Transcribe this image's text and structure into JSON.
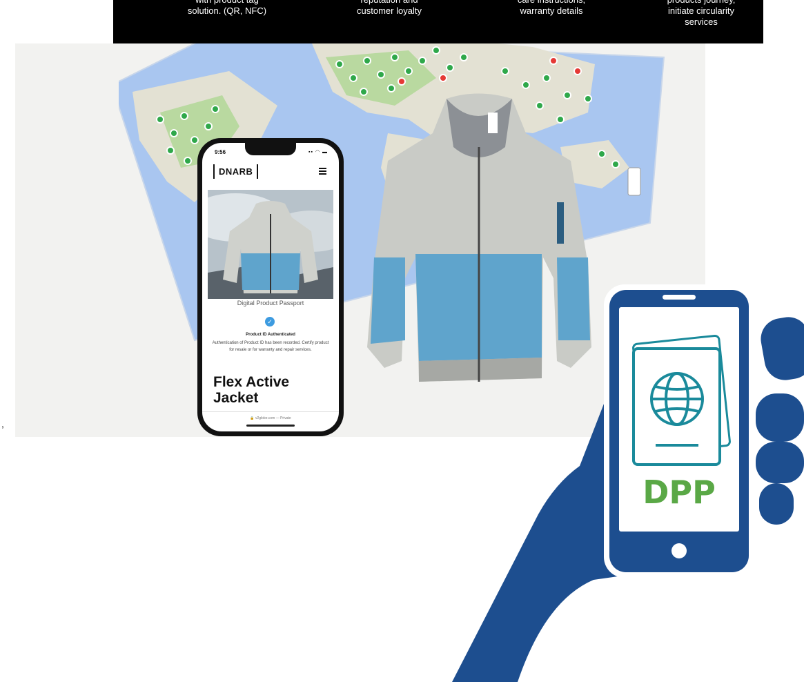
{
  "banner": {
    "col1": [
      "with product tag",
      "solution. (QR, NFC)"
    ],
    "col2": [
      "reputation and",
      "customer loyalty"
    ],
    "col3": [
      "care instructions,",
      "warranty details"
    ],
    "col4": [
      "products journey,",
      "initiate circularity",
      "services"
    ]
  },
  "stray_mark": ",",
  "phone": {
    "time": "9:56",
    "status": "▪▪ ◠ ▬",
    "brand": "DNARB",
    "dpp_title": "Digital Product Passport",
    "check": "✓",
    "auth_title": "Product ID Authenticated",
    "auth_text": "Authentication of Product ID has been recorded. Certify product for resale or for warranty and repair services.",
    "product_name": "Flex Active Jacket",
    "footer": "🔒 v2globe.com — Private"
  },
  "dpp_label": "DPP",
  "colors": {
    "banner": "#000000",
    "navy": "#1d4e8f",
    "teal": "#1a8a9b",
    "green": "#5aa846",
    "map_ocean": "#a9c6f0",
    "map_land": "#e7e4d8",
    "jacket_blue": "#5fa4cc",
    "jacket_grey": "#c9cbc6"
  },
  "icons": [
    "hand-icon",
    "smartphone-icon",
    "passport-icon",
    "globe-icon",
    "menu-icon",
    "check-icon"
  ]
}
